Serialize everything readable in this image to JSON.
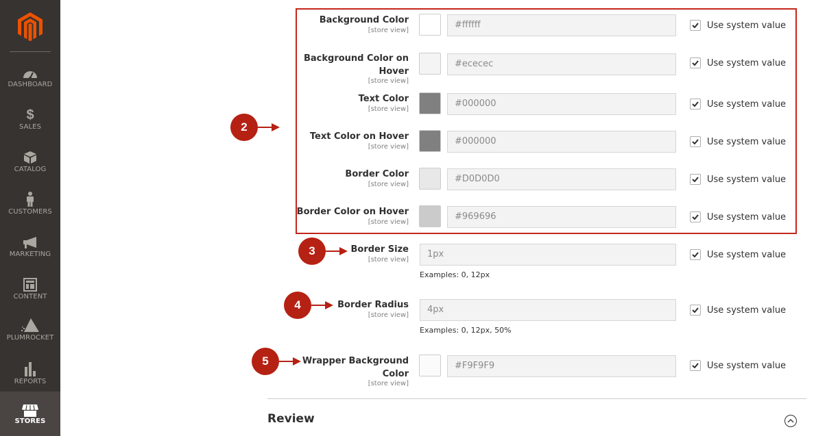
{
  "sidebar": {
    "items": [
      {
        "label": "DASHBOARD",
        "icon": "dashboard-gauge-icon"
      },
      {
        "label": "SALES",
        "icon": "dollar-icon"
      },
      {
        "label": "CATALOG",
        "icon": "box-icon"
      },
      {
        "label": "CUSTOMERS",
        "icon": "person-icon"
      },
      {
        "label": "MARKETING",
        "icon": "megaphone-icon"
      },
      {
        "label": "CONTENT",
        "icon": "layout-icon"
      },
      {
        "label": "PLUMROCKET",
        "icon": "pyramid-icon"
      },
      {
        "label": "REPORTS",
        "icon": "bar-chart-icon"
      },
      {
        "label": "STORES",
        "icon": "storefront-icon",
        "active": true
      }
    ]
  },
  "form": {
    "scope_label": "[store view]",
    "use_system_label": "Use system value",
    "fields": [
      {
        "label": "Background Color",
        "value": "#ffffff",
        "swatch": "#ffffff",
        "use_system": true
      },
      {
        "label": "Background Color on Hover",
        "value": "#ececec",
        "swatch": "#f4f4f4",
        "use_system": true
      },
      {
        "label": "Text Color",
        "value": "#000000",
        "swatch": "#808080",
        "use_system": true
      },
      {
        "label": "Text Color on Hover",
        "value": "#000000",
        "swatch": "#808080",
        "use_system": true
      },
      {
        "label": "Border Color",
        "value": "#D0D0D0",
        "swatch": "#e8e8e8",
        "use_system": true
      },
      {
        "label": "Border Color on Hover",
        "value": "#969696",
        "swatch": "#cbcbcb",
        "use_system": true
      },
      {
        "label": "Border Size",
        "value": "1px",
        "note": "Examples: 0, 12px",
        "use_system": true
      },
      {
        "label": "Border Radius",
        "value": "4px",
        "note": "Examples: 0, 12px, 50%",
        "use_system": true
      },
      {
        "label": "Wrapper Background Color",
        "value": "#F9F9F9",
        "swatch": "#fbfbfb",
        "use_system": true
      }
    ]
  },
  "callouts": [
    "2",
    "3",
    "4",
    "5"
  ],
  "sections": {
    "review_title": "Review"
  },
  "colors": {
    "accent": "#b52113",
    "brand": "#eb5202",
    "sidebar_bg": "#373330"
  }
}
